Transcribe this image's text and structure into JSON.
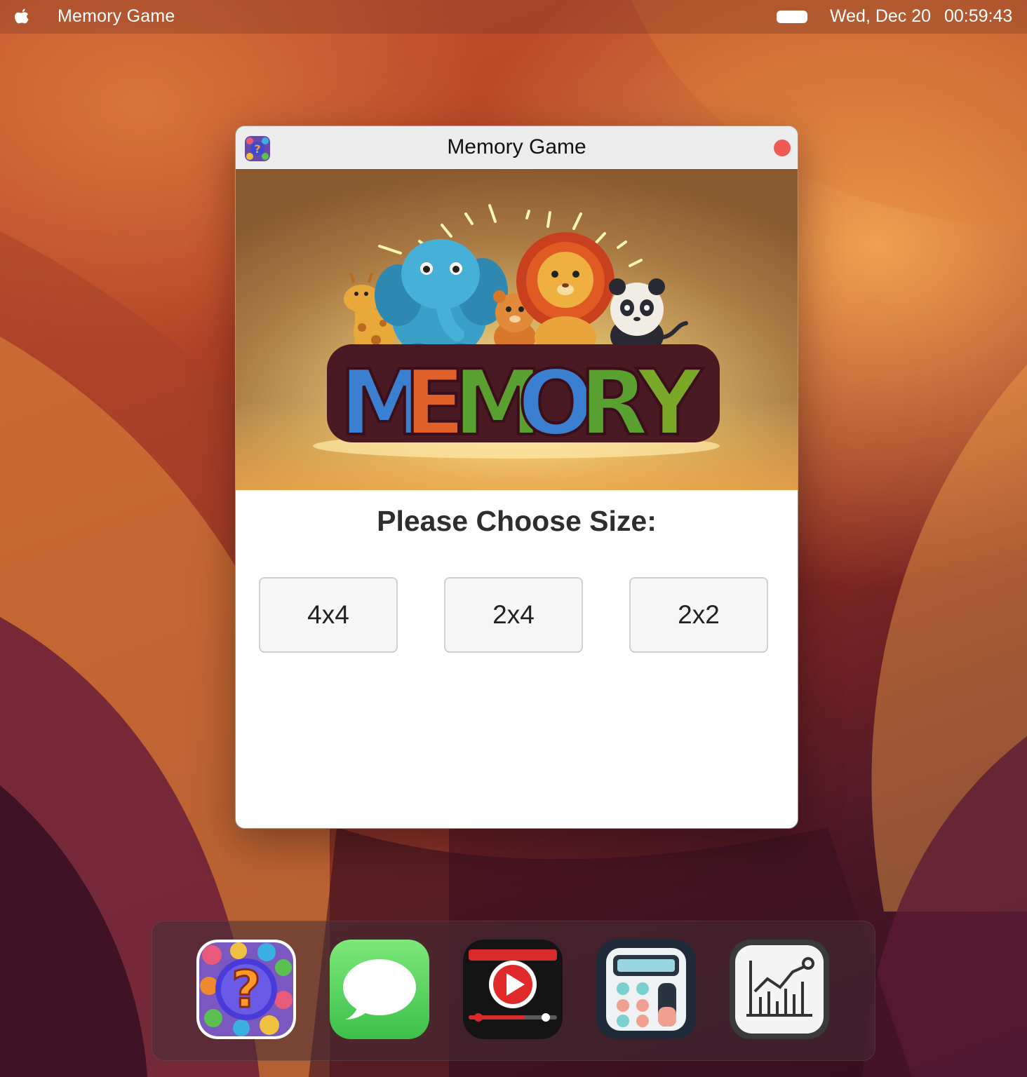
{
  "menubar": {
    "app_name": "Memory Game",
    "date": "Wed, Dec 20",
    "time": "00:59:43"
  },
  "window": {
    "title": "Memory Game",
    "banner": {
      "logo_text": "MEMORY"
    },
    "prompt": "Please Choose Size:",
    "size_options": [
      "4x4",
      "2x4",
      "2x2"
    ]
  },
  "dock": {
    "items": [
      {
        "name": "Memory Game",
        "icon": "memory-game-icon"
      },
      {
        "name": "Messages",
        "icon": "messages-icon"
      },
      {
        "name": "Video Player",
        "icon": "video-player-icon"
      },
      {
        "name": "Calculator",
        "icon": "calculator-icon"
      },
      {
        "name": "Stocks",
        "icon": "chart-icon"
      }
    ]
  },
  "colors": {
    "close_button": "#f05a54",
    "logo_letters": [
      "#3a7fd0",
      "#e0602a",
      "#3a7fd0",
      "#5aa030",
      "#3a7fd0",
      "#5aa030",
      "#7aa828"
    ]
  }
}
